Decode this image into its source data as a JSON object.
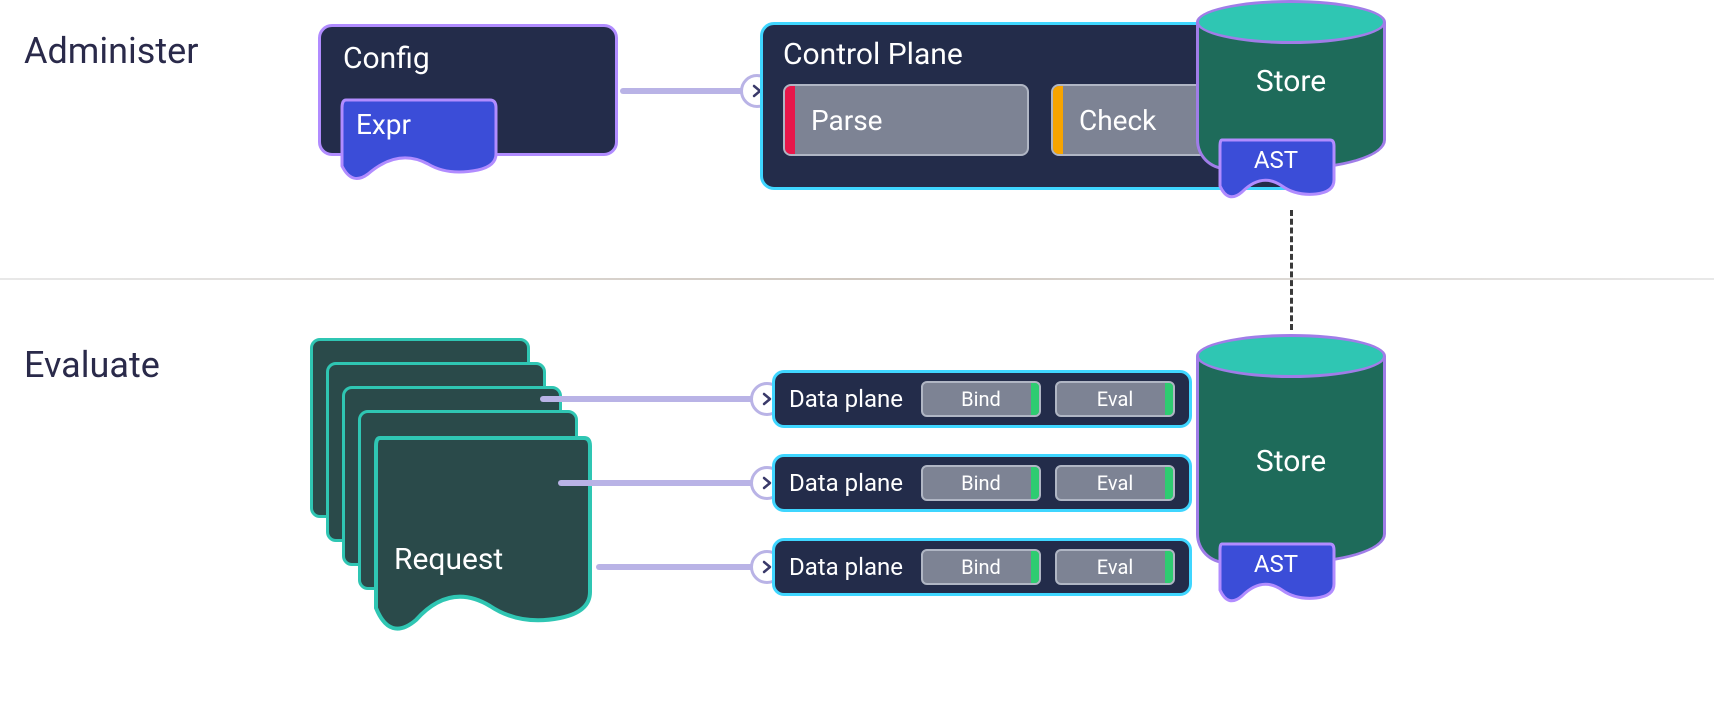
{
  "sections": {
    "administer": "Administer",
    "evaluate": "Evaluate"
  },
  "config": {
    "title": "Config",
    "expr_label": "Expr"
  },
  "control_plane": {
    "title": "Control Plane",
    "parse_label": "Parse",
    "check_label": "Check"
  },
  "store_top": {
    "label": "Store",
    "ast_label": "AST"
  },
  "request": {
    "label": "Request"
  },
  "data_plane_rows": [
    {
      "label": "Data plane",
      "bind": "Bind",
      "eval": "Eval"
    },
    {
      "label": "Data plane",
      "bind": "Bind",
      "eval": "Eval"
    },
    {
      "label": "Data plane",
      "bind": "Bind",
      "eval": "Eval"
    }
  ],
  "store_bottom": {
    "label": "Store",
    "ast_label": "AST"
  },
  "colors": {
    "dark_navy": "#232c4a",
    "purple_border": "#b18cff",
    "cyan_border": "#3fd6ff",
    "teal_lid": "#2fc6b3",
    "teal_body": "#1e6b5a",
    "indigo": "#3b4dd8",
    "grey_box": "#7d8394",
    "red_stripe": "#e8174a",
    "orange_stripe": "#f7a400",
    "green_stripe": "#2ecc71",
    "connector": "#b9b3e6"
  }
}
